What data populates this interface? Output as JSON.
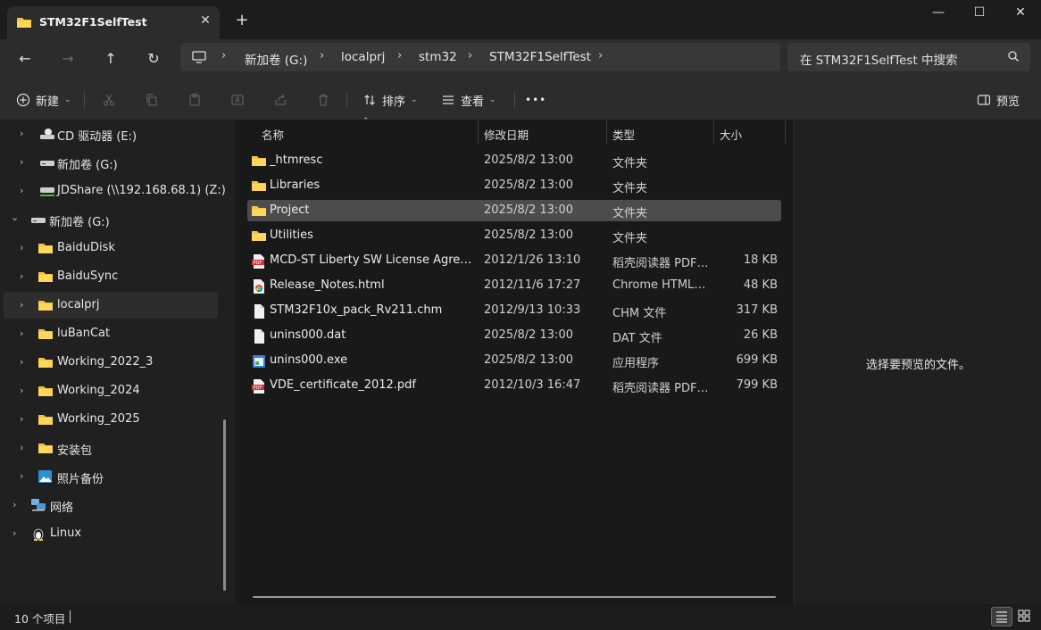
{
  "window": {
    "tab_title": "STM32F1SelfTest",
    "close_tab": "✕",
    "new_tab": "+",
    "minimize": "—",
    "maximize": "☐",
    "close": "✕"
  },
  "nav": {
    "back": "←",
    "forward": "→",
    "up": "↑",
    "refresh": "↻",
    "breadcrumbs": [
      "新加卷 (G:)",
      "localprj",
      "stm32",
      "STM32F1SelfTest"
    ],
    "search_placeholder": "在 STM32F1SelfTest 中搜索"
  },
  "commands": {
    "new_label": "新建",
    "sort_label": "排序",
    "view_label": "查看",
    "more_label": "•••",
    "preview_label": "预览"
  },
  "sidebar": {
    "items": [
      {
        "label": "CD 驱动器 (E:)",
        "icon": "cd-drive-icon"
      },
      {
        "label": "新加卷 (G:)",
        "icon": "drive-icon"
      },
      {
        "label": "JDShare (\\\\192.168.68.1) (Z:)",
        "icon": "network-drive-icon"
      },
      {
        "label": "新加卷 (G:)",
        "icon": "drive-icon",
        "expanded": true
      },
      {
        "label": "BaiduDisk",
        "icon": "folder-icon"
      },
      {
        "label": "BaiduSync",
        "icon": "folder-icon"
      },
      {
        "label": "localprj",
        "icon": "folder-icon",
        "selected": true
      },
      {
        "label": "luBanCat",
        "icon": "folder-icon"
      },
      {
        "label": "Working_2022_3",
        "icon": "folder-icon"
      },
      {
        "label": "Working_2024",
        "icon": "folder-icon"
      },
      {
        "label": "Working_2025",
        "icon": "folder-icon"
      },
      {
        "label": "安装包",
        "icon": "folder-icon"
      },
      {
        "label": "照片备份",
        "icon": "photos-icon"
      },
      {
        "label": "网络",
        "icon": "network-icon"
      },
      {
        "label": "Linux",
        "icon": "linux-icon"
      }
    ]
  },
  "columns": {
    "name": "名称",
    "date": "修改日期",
    "type": "类型",
    "size": "大小"
  },
  "files": [
    {
      "name": "_htmresc",
      "date": "2025/8/2 13:00",
      "type": "文件夹",
      "size": "",
      "icon": "folder-icon"
    },
    {
      "name": "Libraries",
      "date": "2025/8/2 13:00",
      "type": "文件夹",
      "size": "",
      "icon": "folder-icon"
    },
    {
      "name": "Project",
      "date": "2025/8/2 13:00",
      "type": "文件夹",
      "size": "",
      "icon": "folder-icon",
      "selected": true
    },
    {
      "name": "Utilities",
      "date": "2025/8/2 13:00",
      "type": "文件夹",
      "size": "",
      "icon": "folder-icon"
    },
    {
      "name": "MCD-ST Liberty SW License Agreeme...",
      "date": "2012/1/26 13:10",
      "type": "稻壳阅读器 PDF ...",
      "size": "18 KB",
      "icon": "pdf-icon"
    },
    {
      "name": "Release_Notes.html",
      "date": "2012/11/6 17:27",
      "type": "Chrome HTML D...",
      "size": "48 KB",
      "icon": "chrome-html-icon"
    },
    {
      "name": "STM32F10x_pack_Rv211.chm",
      "date": "2012/9/13 10:33",
      "type": "CHM 文件",
      "size": "317 KB",
      "icon": "file-icon"
    },
    {
      "name": "unins000.dat",
      "date": "2025/8/2 13:00",
      "type": "DAT 文件",
      "size": "26 KB",
      "icon": "file-icon"
    },
    {
      "name": "unins000.exe",
      "date": "2025/8/2 13:00",
      "type": "应用程序",
      "size": "699 KB",
      "icon": "exe-icon"
    },
    {
      "name": "VDE_certificate_2012.pdf",
      "date": "2012/10/3 16:47",
      "type": "稻壳阅读器 PDF ...",
      "size": "799 KB",
      "icon": "pdf-icon"
    }
  ],
  "preview": {
    "message": "选择要预览的文件。"
  },
  "status": {
    "count": "10 个项目"
  },
  "colors": {
    "accent_folder": "#f5c242",
    "selected_row": "#4c4c4c",
    "pdf_red": "#d13438"
  }
}
